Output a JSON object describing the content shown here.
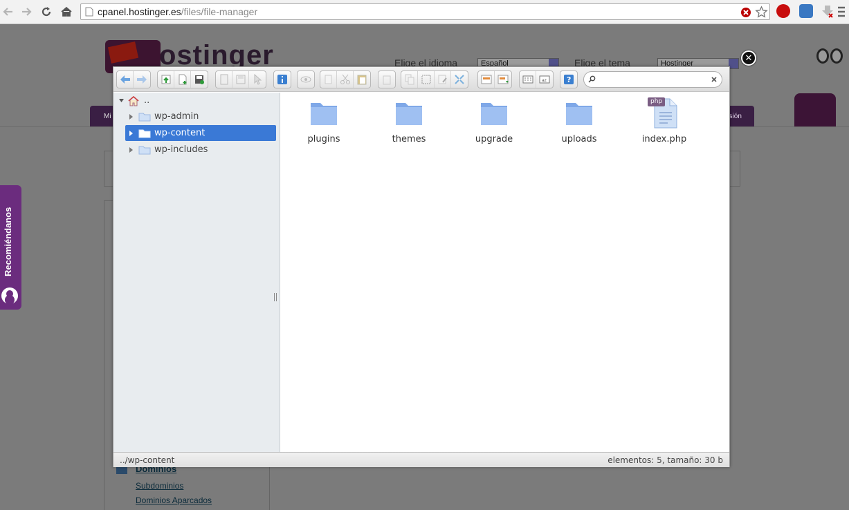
{
  "browser": {
    "url_host": "cpanel.hostinger.es",
    "url_path": "/files/file-manager"
  },
  "background_page": {
    "logo_text": "ostinger",
    "language_label": "Elige el idioma",
    "language_value": "Español",
    "theme_label": "Elige el tema",
    "theme_value": "Hostinger",
    "nav_left": "Mi",
    "nav_right": "esión",
    "recommend_label": "Recomiéndanos",
    "links": [
      "Dominios",
      "Subdominios",
      "Dominios Aparcados"
    ]
  },
  "file_manager": {
    "search": {
      "value": "",
      "placeholder": ""
    },
    "tree": {
      "root_label": "..",
      "items": [
        {
          "label": "wp-admin",
          "selected": false
        },
        {
          "label": "wp-content",
          "selected": true
        },
        {
          "label": "wp-includes",
          "selected": false
        }
      ]
    },
    "files": [
      {
        "name": "plugins",
        "type": "folder"
      },
      {
        "name": "themes",
        "type": "folder"
      },
      {
        "name": "upgrade",
        "type": "folder"
      },
      {
        "name": "uploads",
        "type": "folder"
      },
      {
        "name": "index.php",
        "type": "php",
        "badge": "php"
      }
    ],
    "status": {
      "path": "../wp-content",
      "info": "elementos: 5, tamaño: 30 b"
    }
  },
  "colors": {
    "selection": "#3a79d6",
    "folder": "#8fb4ec",
    "accent_purple": "#6b2c7e"
  }
}
